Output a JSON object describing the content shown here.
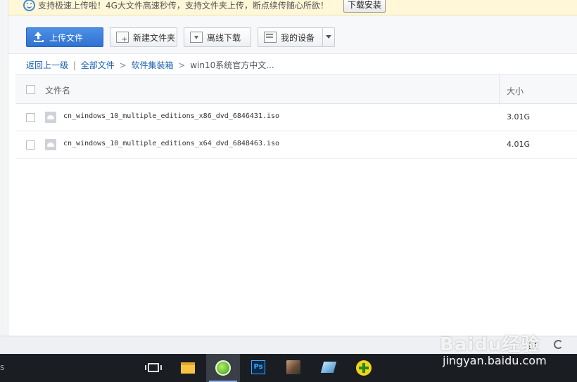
{
  "notice": {
    "text": "支持极速上传啦！4G大文件高速秒传，支持文件夹上传，断点续传随心所欲！",
    "button": "下载安装"
  },
  "toolbar": {
    "upload": "上传文件",
    "new_folder": "新建文件夹",
    "offline_download": "离线下载",
    "my_devices": "我的设备"
  },
  "breadcrumb": {
    "back": "返回上一级",
    "all_files": "全部文件",
    "folder": "软件集装箱",
    "current": "win10系统官方中文...",
    "sep": ">",
    "pipe": "|"
  },
  "table": {
    "headers": {
      "name": "文件名",
      "size": "大小"
    },
    "rows": [
      {
        "name": "cn_windows_10_multiple_editions_x86_dvd_6846431.iso",
        "size": "3.01G"
      },
      {
        "name": "cn_windows_10_multiple_editions_x64_dvd_6848463.iso",
        "size": "4.01G"
      }
    ]
  },
  "taskbar": {
    "start_fragment": "s",
    "ps_label": "Ps",
    "apps": [
      "task-view",
      "file-explorer",
      "browser",
      "photoshop",
      "photo",
      "tool",
      "add-app"
    ]
  },
  "watermark": {
    "logo": "Baidu经验",
    "site": "jingyan.baidu.com"
  },
  "colors": {
    "accent": "#2f72d2",
    "notice_bg": "#fff7d8",
    "link": "#1a5fb4"
  }
}
